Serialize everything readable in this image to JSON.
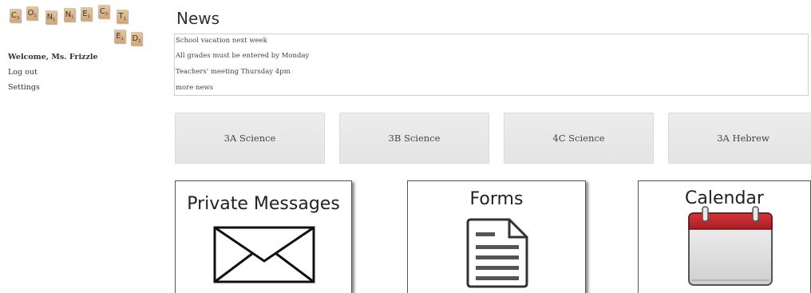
{
  "logo": {
    "row1": [
      {
        "letter": "C",
        "sub": "3"
      },
      {
        "letter": "O",
        "sub": "1"
      },
      {
        "letter": "N",
        "sub": "1"
      },
      {
        "letter": "N",
        "sub": "1"
      },
      {
        "letter": "E",
        "sub": "1"
      },
      {
        "letter": "C",
        "sub": "3"
      },
      {
        "letter": "T",
        "sub": "1"
      }
    ],
    "row2": [
      {
        "letter": "E",
        "sub": "1"
      },
      {
        "letter": "D",
        "sub": "2"
      }
    ]
  },
  "sidebar": {
    "welcome": "Welcome, Ms. Frizzle",
    "logout": "Log out",
    "settings": "Settings"
  },
  "news": {
    "title": "News",
    "items": [
      "School vacation next week",
      "All grades must be entered by Monday",
      "Teachers' meeting Thursday 4pm",
      "more news"
    ]
  },
  "classes": [
    "3A Science",
    "3B Science",
    "4C Science",
    "3A Hebrew"
  ],
  "cards": {
    "private_messages": "Private Messages",
    "forms": "Forms",
    "calendar": "Calendar"
  },
  "colors": {
    "tile": "#d9b890",
    "calendar_red": "#c0272d",
    "button_bg": "#e8e8e8"
  }
}
